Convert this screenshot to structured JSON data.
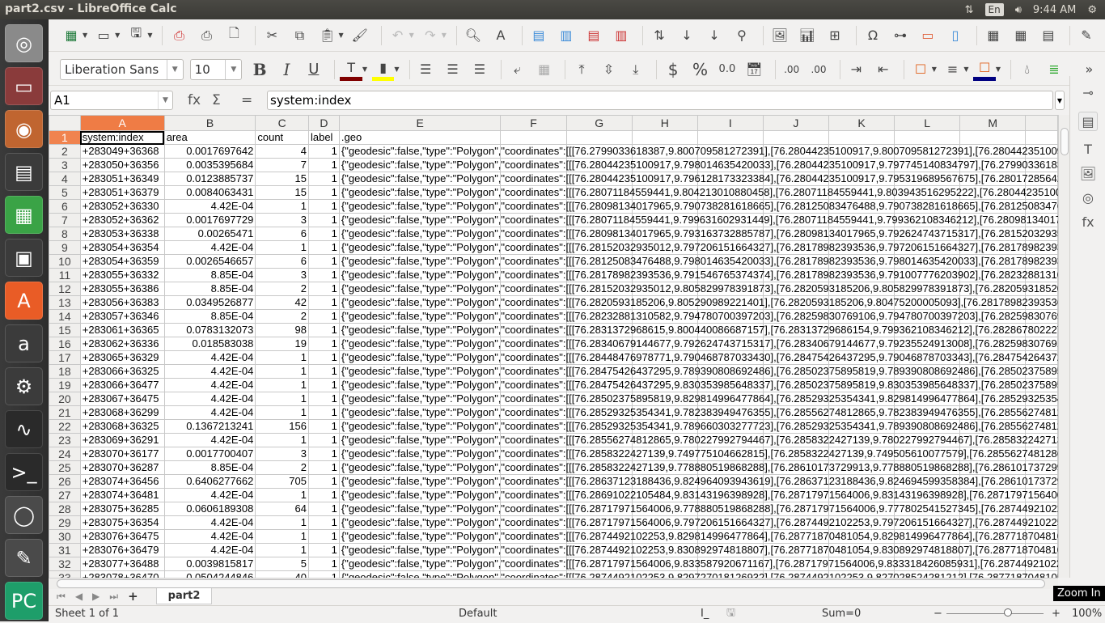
{
  "window": {
    "title": "part2.csv - LibreOffice Calc"
  },
  "tray": {
    "network_icon": "network-updown-icon",
    "keyboard": "En",
    "volume_icon": "volume-icon",
    "clock": "9:44 AM",
    "power_icon": "power-gear-icon"
  },
  "launcher": [
    {
      "name": "ubuntu-dash",
      "glyph": "◎",
      "color": "#8a8a8a"
    },
    {
      "name": "files",
      "glyph": "▭",
      "color": "#8a3b3b"
    },
    {
      "name": "firefox",
      "glyph": "◉",
      "color": "#c06530"
    },
    {
      "name": "libreoffice-writer",
      "glyph": "▤",
      "color": "#3b3b3b"
    },
    {
      "name": "libreoffice-calc",
      "glyph": "▦",
      "color": "#3aa346"
    },
    {
      "name": "libreoffice-impress",
      "glyph": "▣",
      "color": "#3b3b3b"
    },
    {
      "name": "ubuntu-software",
      "glyph": "A",
      "color": "#e95c26"
    },
    {
      "name": "amazon",
      "glyph": "a",
      "color": "#3b3b3b"
    },
    {
      "name": "system-settings",
      "glyph": "⚙",
      "color": "#3b3b3b"
    },
    {
      "name": "system-monitor",
      "glyph": "∿",
      "color": "#2a2a2a"
    },
    {
      "name": "terminal",
      "glyph": ">_",
      "color": "#2a2a2a"
    },
    {
      "name": "disks",
      "glyph": "◯",
      "color": "#4a4a4a"
    },
    {
      "name": "text-editor",
      "glyph": "✎",
      "color": "#4a4a4a"
    },
    {
      "name": "pycharm",
      "glyph": "PC",
      "color": "#1e9e6a"
    }
  ],
  "toolbar": {
    "font_name": "Liberation Sans",
    "font_size": "10",
    "bold": "B",
    "italic": "I",
    "underline": "U",
    "currency": "$",
    "percent": "%",
    "number": "0.0",
    "overflow": "»",
    "font_color": "#800000",
    "highlight_color": "#ffff00",
    "border_color": "#e0601a",
    "cell_bg_color": "#000080"
  },
  "formula_bar": {
    "cell_ref": "A1",
    "fx": "fx",
    "sum": "Σ",
    "equals": "=",
    "content": "system:index"
  },
  "columns": [
    "A",
    "B",
    "C",
    "D",
    "E",
    "F",
    "G",
    "H",
    "I",
    "J",
    "K",
    "L",
    "M"
  ],
  "rows": [
    {
      "n": "1",
      "a": "system:index",
      "b": "area",
      "c": "count",
      "d": "label",
      "geo": ".geo",
      "header": true
    },
    {
      "n": "2",
      "a": "+283049+36368",
      "b": "0.0017697642",
      "c": "4",
      "d": "1",
      "geo": "{\"geodesic\":false,\"type\":\"Polygon\",\"coordinates\":[[[76.2799033618387,9.800709581272391],[76.28044235100917,9.800709581272391],[76.28044235100917,9.800709581272391],[76.2804423510091"
    },
    {
      "n": "3",
      "a": "+283050+36356",
      "b": "0.0035395684",
      "c": "7",
      "d": "1",
      "geo": "{\"geodesic\":false,\"type\":\"Polygon\",\"coordinates\":[[[76.28044235100917,9.798014635420033],[76.28044235100917,9.797745140834797],[76.2799033618387"
    },
    {
      "n": "4",
      "a": "+283051+36349",
      "b": "0.0123885737",
      "c": "15",
      "d": "1",
      "geo": "{\"geodesic\":false,\"type\":\"Polygon\",\"coordinates\":[[[76.28044235100917,9.796128173323384],[76.28044235100917,9.795319689567675],[76.2801728564233"
    },
    {
      "n": "5",
      "a": "+283051+36379",
      "b": "0.0084063431",
      "c": "15",
      "d": "1",
      "geo": "{\"geodesic\":false,\"type\":\"Polygon\",\"coordinates\":[[[76.28071184559441,9.804213010880458],[76.28071184559441,9.803943516295222],[76.2804423510091"
    },
    {
      "n": "6",
      "a": "+283052+36330",
      "b": "4.42E-04",
      "c": "1",
      "d": "1",
      "geo": "{\"geodesic\":false,\"type\":\"Polygon\",\"coordinates\":[[[76.28098134017965,9.790738281618665],[76.28125083476488,9.790738281618665],[76.2812508347648"
    },
    {
      "n": "7",
      "a": "+283052+36362",
      "b": "0.0017697729",
      "c": "3",
      "d": "1",
      "geo": "{\"geodesic\":false,\"type\":\"Polygon\",\"coordinates\":[[[76.28071184559441,9.799631602931449],[76.28071184559441,9.799362108346212],[76.2809813401796"
    },
    {
      "n": "8",
      "a": "+283053+36338",
      "b": "0.00265471",
      "c": "6",
      "d": "1",
      "geo": "{\"geodesic\":false,\"type\":\"Polygon\",\"coordinates\":[[[76.28098134017965,9.793163732885787],[76.28098134017965,9.792624743715317],[76.2815203293501"
    },
    {
      "n": "9",
      "a": "+283054+36354",
      "b": "4.42E-04",
      "c": "1",
      "d": "1",
      "geo": "{\"geodesic\":false,\"type\":\"Polygon\",\"coordinates\":[[[76.28152032935012,9.797206151664327],[76.28178982393536,9.797206151664327],[76.2817898239353"
    },
    {
      "n": "10",
      "a": "+283054+36359",
      "b": "0.0026546657",
      "c": "6",
      "d": "1",
      "geo": "{\"geodesic\":false,\"type\":\"Polygon\",\"coordinates\":[[[76.28125083476488,9.798014635420033],[76.28178982393536,9.798014635420033],[76.2817898239353"
    },
    {
      "n": "11",
      "a": "+283055+36332",
      "b": "8.85E-04",
      "c": "3",
      "d": "1",
      "geo": "{\"geodesic\":false,\"type\":\"Polygon\",\"coordinates\":[[[76.28178982393536,9.791546765374374],[76.28178982393536,9.791007776203902],[76.2823288131058"
    },
    {
      "n": "12",
      "a": "+283055+36386",
      "b": "8.85E-04",
      "c": "2",
      "d": "1",
      "geo": "{\"geodesic\":false,\"type\":\"Polygon\",\"coordinates\":[[[76.28152032935012,9.805829978391873],[76.2820593185206,9.805829978391873],[76.2820593185206"
    },
    {
      "n": "13",
      "a": "+283056+36383",
      "b": "0.0349526877",
      "c": "42",
      "d": "1",
      "geo": "{\"geodesic\":false,\"type\":\"Polygon\",\"coordinates\":[[[76.2820593185206,9.805290989221401],[76.2820593185206,9.80475200005093],[76.28178982393536,"
    },
    {
      "n": "14",
      "a": "+283057+36346",
      "b": "8.85E-04",
      "c": "2",
      "d": "1",
      "geo": "{\"geodesic\":false,\"type\":\"Polygon\",\"coordinates\":[[[76.28232881310582,9.794780700397203],[76.28259830769106,9.794780700397203],[76.2825983076910"
    },
    {
      "n": "15",
      "a": "+283061+36365",
      "b": "0.0783132073",
      "c": "98",
      "d": "1",
      "geo": "{\"geodesic\":false,\"type\":\"Polygon\",\"coordinates\":[[[76.2831372968615,9.800440086687157],[76.28313729686154,9.799362108346212],[76.2828678022276"
    },
    {
      "n": "16",
      "a": "+283062+36336",
      "b": "0.018583038",
      "c": "19",
      "d": "1",
      "geo": "{\"geodesic\":false,\"type\":\"Polygon\",\"coordinates\":[[[76.28340679144677,9.792624743715317],[76.28340679144677,9.79235524913008],[76.2825983076910"
    },
    {
      "n": "17",
      "a": "+283065+36329",
      "b": "4.42E-04",
      "c": "1",
      "d": "1",
      "geo": "{\"geodesic\":false,\"type\":\"Polygon\",\"coordinates\":[[[76.28448476978771,9.790468787033430],[76.28475426437295,9.79046878703343],[76.28475426437295"
    },
    {
      "n": "18",
      "a": "+283066+36325",
      "b": "4.42E-04",
      "c": "1",
      "d": "1",
      "geo": "{\"geodesic\":false,\"type\":\"Polygon\",\"coordinates\":[[[76.28475426437295,9.789390808692486],[76.28502375895819,9.789390808692486],[76.2850237589581"
    },
    {
      "n": "19",
      "a": "+283066+36477",
      "b": "4.42E-04",
      "c": "1",
      "d": "1",
      "geo": "{\"geodesic\":false,\"type\":\"Polygon\",\"coordinates\":[[[76.28475426437295,9.830353985648337],[76.28502375895819,9.830353985648337],[76.2850237589581"
    },
    {
      "n": "20",
      "a": "+283067+36475",
      "b": "4.42E-04",
      "c": "1",
      "d": "1",
      "geo": "{\"geodesic\":false,\"type\":\"Polygon\",\"coordinates\":[[[76.28502375895819,9.829814996477864],[76.28529325354341,9.829814996477864],[76.2852932535434"
    },
    {
      "n": "21",
      "a": "+283068+36299",
      "b": "4.42E-04",
      "c": "1",
      "d": "1",
      "geo": "{\"geodesic\":false,\"type\":\"Polygon\",\"coordinates\":[[[76.28529325354341,9.782383949476355],[76.28556274812865,9.782383949476355],[76.2855627481286"
    },
    {
      "n": "22",
      "a": "+283068+36325",
      "b": "0.1367213241",
      "c": "156",
      "d": "1",
      "geo": "{\"geodesic\":false,\"type\":\"Polygon\",\"coordinates\":[[[76.28529325354341,9.789660303277723],[76.28529325354341,9.789390808692486],[76.2855627481286"
    },
    {
      "n": "23",
      "a": "+283069+36291",
      "b": "4.42E-04",
      "c": "1",
      "d": "1",
      "geo": "{\"geodesic\":false,\"type\":\"Polygon\",\"coordinates\":[[[76.28556274812865,9.780227992794467],[76.2858322427139,9.780227992794467],[76.2858322427139"
    },
    {
      "n": "24",
      "a": "+283070+36177",
      "b": "0.0017700407",
      "c": "3",
      "d": "1",
      "geo": "{\"geodesic\":false,\"type\":\"Polygon\",\"coordinates\":[[[76.2858322427139,9.749775104662815],[76.2858322427139,9.749505610077579],[76.2855627481286"
    },
    {
      "n": "25",
      "a": "+283070+36287",
      "b": "8.85E-04",
      "c": "2",
      "d": "1",
      "geo": "{\"geodesic\":false,\"type\":\"Polygon\",\"coordinates\":[[[76.2858322427139,9.778880519868288],[76.28610173729913,9.778880519868288],[76.2861017372991"
    },
    {
      "n": "26",
      "a": "+283074+36456",
      "b": "0.6406277662",
      "c": "705",
      "d": "1",
      "geo": "{\"geodesic\":false,\"type\":\"Polygon\",\"coordinates\":[[[76.28637123188436,9.824964093943619],[76.28637123188436,9.824694599358384],[76.2861017372990"
    },
    {
      "n": "27",
      "a": "+283074+36481",
      "b": "4.42E-04",
      "c": "1",
      "d": "1",
      "geo": "{\"geodesic\":false,\"type\":\"Polygon\",\"coordinates\":[[[76.28691022105484,9.83143196398928],[76.28717971564006,9.83143196398928],[76.28717971564006"
    },
    {
      "n": "28",
      "a": "+283075+36285",
      "b": "0.0606189308",
      "c": "64",
      "d": "1",
      "geo": "{\"geodesic\":false,\"type\":\"Polygon\",\"coordinates\":[[[76.28717971564006,9.778880519868288],[76.28717971564006,9.777802541527345],[76.2874492102253"
    },
    {
      "n": "29",
      "a": "+283075+36354",
      "b": "4.42E-04",
      "c": "1",
      "d": "1",
      "geo": "{\"geodesic\":false,\"type\":\"Polygon\",\"coordinates\":[[[76.28717971564006,9.797206151664327],[76.2874492102253,9.797206151664327],[76.2874492102253"
    },
    {
      "n": "30",
      "a": "+283076+36475",
      "b": "4.42E-04",
      "c": "1",
      "d": "1",
      "geo": "{\"geodesic\":false,\"type\":\"Polygon\",\"coordinates\":[[[76.2874492102253,9.829814996477864],[76.28771870481054,9.829814996477864],[76.2877187048105"
    },
    {
      "n": "31",
      "a": "+283076+36479",
      "b": "4.42E-04",
      "c": "1",
      "d": "1",
      "geo": "{\"geodesic\":false,\"type\":\"Polygon\",\"coordinates\":[[[76.2874492102253,9.830892974818807],[76.28771870481054,9.830892974818807],[76.2877187048105"
    },
    {
      "n": "32",
      "a": "+283077+36488",
      "b": "0.0039815817",
      "c": "5",
      "d": "1",
      "geo": "{\"geodesic\":false,\"type\":\"Polygon\",\"coordinates\":[[[76.28717971564006,9.833587920671167],[76.28717971564006,9.833318426085931],[76.2874492102253"
    },
    {
      "n": "33",
      "a": "+283078+36470",
      "b": "0.0504244846",
      "c": "40",
      "d": "1",
      "geo": "{\"geodesic\":false,\"type\":\"Polygon\",\"coordinates\":[[[76.2874492102253,9.829727018126932],[76.2874492102253,9.827028524281212],[76.2877187048105"
    }
  ],
  "sheet_tabs": {
    "add_icon": "+",
    "active": "part2"
  },
  "status_bar": {
    "sheet": "Sheet 1 of 1",
    "style": "Default",
    "sum": "Sum=0",
    "zoom": "100%",
    "zoom_percent": 100
  },
  "tooltip": "Zoom In"
}
